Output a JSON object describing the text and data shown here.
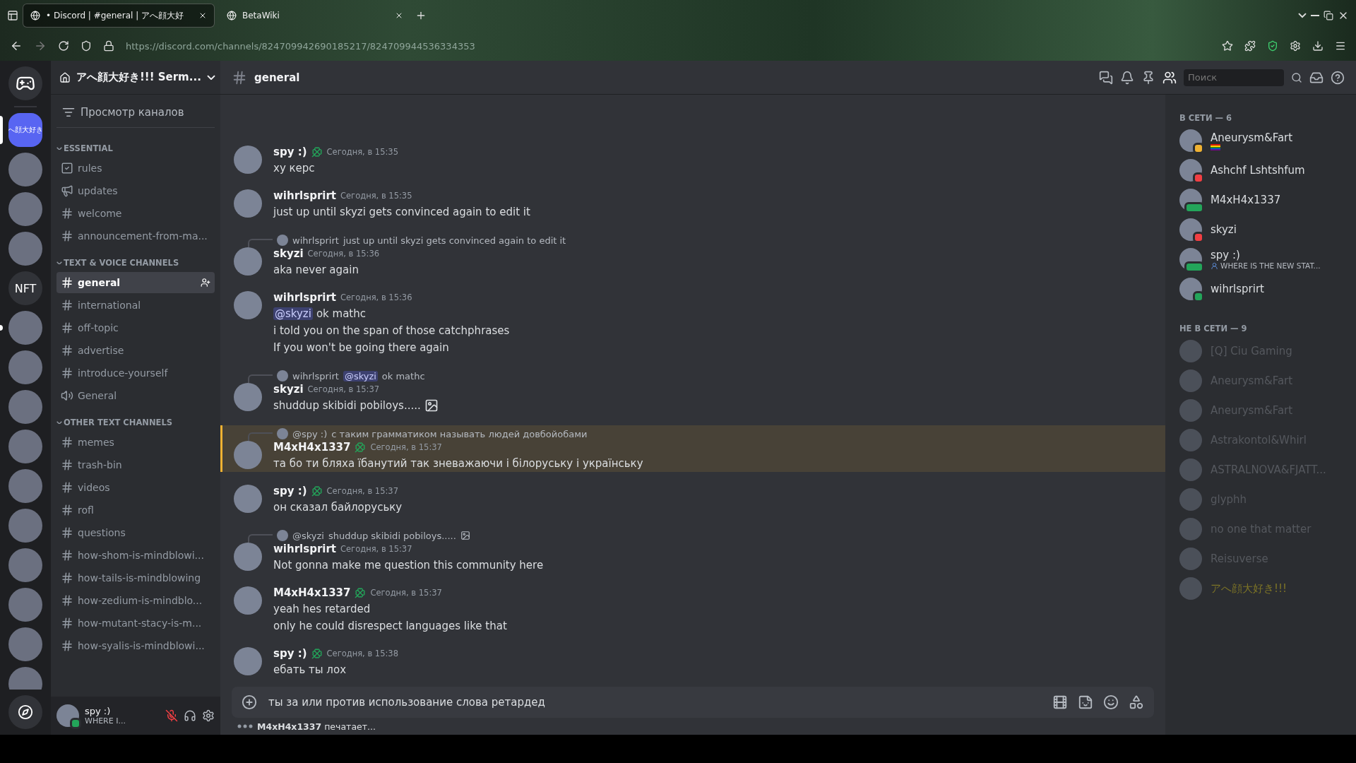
{
  "browser": {
    "tabs": [
      {
        "title": "• Discord | #general | アへ顔大好",
        "selected": true
      },
      {
        "title": "BetaWiki",
        "selected": false
      }
    ],
    "url": "https://discord.com/channels/824709942690185217/824709944536334353"
  },
  "servers": [
    {
      "label": "へ顔大好き",
      "selected": true
    },
    {
      "selected": false
    },
    {
      "selected": false
    },
    {
      "selected": false
    },
    {
      "label": "NFT",
      "selected": false
    },
    {
      "selected": false,
      "unread": true
    },
    {
      "selected": false
    },
    {
      "selected": false
    },
    {
      "selected": false
    },
    {
      "selected": false
    },
    {
      "selected": false
    },
    {
      "selected": false
    },
    {
      "selected": false
    },
    {
      "selected": false
    },
    {
      "selected": false
    }
  ],
  "server": {
    "name": "アへ顔大好き!!! Serm...",
    "browse": "Просмотр каналов"
  },
  "categories": [
    {
      "name": "ESSENTIAL",
      "channels": [
        {
          "name": "rules",
          "kind": "rules",
          "selected": false
        },
        {
          "name": "updates",
          "kind": "announce",
          "selected": false
        },
        {
          "name": "welcome",
          "kind": "text",
          "selected": false
        },
        {
          "name": "announcement-from-ma...",
          "kind": "text",
          "selected": false
        }
      ]
    },
    {
      "name": "TEXT & VOICE CHANNELS",
      "channels": [
        {
          "name": "general",
          "kind": "text",
          "selected": true
        },
        {
          "name": "international",
          "kind": "text",
          "selected": false
        },
        {
          "name": "off-topic",
          "kind": "text",
          "selected": false
        },
        {
          "name": "advertise",
          "kind": "text",
          "selected": false
        },
        {
          "name": "introduce-yourself",
          "kind": "text",
          "selected": false
        },
        {
          "name": "General",
          "kind": "voice",
          "selected": false
        }
      ]
    },
    {
      "name": "OTHER TEXT CHANNELS",
      "channels": [
        {
          "name": "memes",
          "kind": "text",
          "selected": false
        },
        {
          "name": "trash-bin",
          "kind": "text",
          "selected": false
        },
        {
          "name": "videos",
          "kind": "text",
          "selected": false
        },
        {
          "name": "rofl",
          "kind": "text",
          "selected": false
        },
        {
          "name": "questions",
          "kind": "text",
          "selected": false
        },
        {
          "name": "how-shom-is-mindblowi...",
          "kind": "text",
          "selected": false
        },
        {
          "name": "how-tails-is-mindblowing",
          "kind": "text",
          "selected": false
        },
        {
          "name": "how-zedium-is-mindblo...",
          "kind": "text",
          "selected": false
        },
        {
          "name": "how-mutant-stacy-is-m...",
          "kind": "text",
          "selected": false
        },
        {
          "name": "how-syalis-is-mindblowi...",
          "kind": "text",
          "selected": false
        }
      ]
    }
  ],
  "user": {
    "name": "spy :)",
    "status": "WHERE I..."
  },
  "channel": {
    "name": "general",
    "search_placeholder": "Поиск"
  },
  "messages": [
    {
      "author": "spy :)",
      "badge": true,
      "time": "Сегодня, в 15:35",
      "highlighted": false,
      "lines": [
        {
          "text": "ху керс"
        }
      ]
    },
    {
      "author": "wihrlsprirt",
      "badge": false,
      "time": "Сегодня, в 15:35",
      "highlighted": false,
      "lines": [
        {
          "text": "just up until skyzi gets convinced again to edit it"
        }
      ]
    },
    {
      "author": "skyzi",
      "badge": false,
      "time": "Сегодня, в 15:36",
      "highlighted": false,
      "reply": {
        "author": "wihrlsprirt",
        "text": "just up until skyzi gets convinced again to edit it"
      },
      "lines": [
        {
          "text": "aka never again"
        }
      ]
    },
    {
      "author": "wihrlsprirt",
      "badge": false,
      "time": "Сегодня, в 15:36",
      "highlighted": false,
      "lines": [
        {
          "mention": "@skyzi",
          "text": "ok mathc"
        },
        {
          "text": "i told you on the span of those catchphrases"
        },
        {
          "text": "If you won't be going there again"
        }
      ]
    },
    {
      "author": "skyzi",
      "badge": false,
      "time": "Сегодня, в 15:37",
      "highlighted": false,
      "reply": {
        "author": "wihrlsprirt",
        "mention": "@skyzi",
        "text": "ok mathc"
      },
      "lines": [
        {
          "text": "shuddup skibidi pobiloys.....",
          "sticker": true
        }
      ]
    },
    {
      "author": "M4xH4x1337",
      "badge": true,
      "time": "Сегодня, в 15:37",
      "highlighted": true,
      "reply": {
        "author": "@spy :)",
        "text": "с таким грамматиком называть людей довбойобами"
      },
      "lines": [
        {
          "text": "та бо ти бляха їбанутий так зневажаючи і білоруську і українську"
        }
      ]
    },
    {
      "author": "spy :)",
      "badge": true,
      "time": "Сегодня, в 15:37",
      "highlighted": false,
      "lines": [
        {
          "text": "он сказал байлоруську"
        }
      ]
    },
    {
      "author": "wihrlsprirt",
      "badge": false,
      "time": "Сегодня, в 15:37",
      "highlighted": false,
      "reply": {
        "author": "@skyzi",
        "text": "shuddup skibidi pobiloys.....",
        "sticker": true
      },
      "lines": [
        {
          "text": "Not gonna make me question this community here"
        }
      ]
    },
    {
      "author": "M4xH4x1337",
      "badge": true,
      "time": "Сегодня, в 15:37",
      "highlighted": false,
      "lines": [
        {
          "text": "yeah hes retarded"
        },
        {
          "text": "only he could disrespect languages like that"
        }
      ]
    },
    {
      "author": "spy :)",
      "badge": true,
      "time": "Сегодня, в 15:38",
      "highlighted": false,
      "lines": [
        {
          "text": "ебать ты лох"
        }
      ]
    }
  ],
  "composer": {
    "value": "ты за или против использование слова ретардед"
  },
  "typing": "**M4xH4x1337** печатает...",
  "members": {
    "online_heading": "В СЕТИ — 6",
    "online": [
      {
        "name": "Aneurysm&Fart",
        "kind": "idle",
        "activity": {
          "kind": "flag"
        }
      },
      {
        "name": "Ashchf Lshtshfum",
        "kind": "dnd"
      },
      {
        "name": "M4xH4x1337",
        "kind": "mobile"
      },
      {
        "name": "skyzi",
        "kind": "dnd"
      },
      {
        "name": "spy :)",
        "kind": "mobile",
        "activity": {
          "kind": "speaking",
          "text": "WHERE IS THE NEW STAT..."
        }
      },
      {
        "name": "wihrlsprirt",
        "kind": "online"
      }
    ],
    "offline_heading": "НЕ В СЕТИ — 9",
    "offline": [
      {
        "name": "[Q] Ciu Gaming",
        "color": "#55585e"
      },
      {
        "name": "Aneurysm&Fart",
        "color": "#55585e"
      },
      {
        "name": "Aneurysm&Fart",
        "color": "#55585e"
      },
      {
        "name": "Astrakontol&Whirl",
        "color": "#55585e"
      },
      {
        "name": "ASTRALNOVA&FJATT...",
        "color": "#55585e"
      },
      {
        "name": "glyphh",
        "color": "#55585e"
      },
      {
        "name": "no one that matter",
        "color": "#55585e"
      },
      {
        "name": "Reisuverse",
        "color": "#55585e"
      },
      {
        "name": "アへ顔大好き!!!",
        "color": "#7d7426"
      }
    ]
  }
}
